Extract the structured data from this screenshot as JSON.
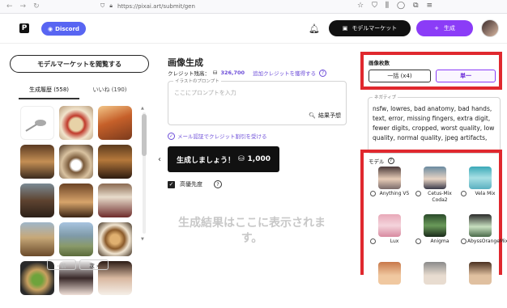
{
  "browser": {
    "url": "https://pixai.art/submit/gen"
  },
  "header": {
    "discord_label": "Discord",
    "market_label": "モデルマーケット",
    "create_label": "生成"
  },
  "left": {
    "browse_label": "モデルマーケットを閲覧する",
    "tabs": [
      {
        "label": "生成履歴 (558)"
      },
      {
        "label": "いいね (190)"
      }
    ],
    "pager": {
      "prev": "‹ 前",
      "next": "次 ›"
    }
  },
  "main": {
    "title": "画像生成",
    "credits_label": "クレジット残高：",
    "credits_value": "326,700",
    "credits_link": "追加クレジットを獲得する",
    "prompt_label": "イラストのプロンプト",
    "prompt_placeholder": "ここにプロンプトを入力",
    "predict_label": "結果予想",
    "mail_label": "メール認証でクレジット割引を受ける",
    "generate_label": "生成しましょう！",
    "generate_cost": "1,000",
    "priority_label": "高優先度",
    "result_placeholder": "生成結果はここに表示されます。"
  },
  "settings": {
    "count_label": "画像枚数",
    "count_options": [
      "一括 (x4)",
      "単一"
    ],
    "negative_label": "ネガティブ",
    "negative_text": "nsfw, lowres, bad anatomy, bad hands, text, error, missing fingers, extra digit, fewer digits, cropped, worst quality, low quality, normal quality, jpeg artifacts,",
    "model_label": "モデル",
    "models": [
      {
        "name": "Anything V5"
      },
      {
        "name": "Cetus-Mix Coda2"
      },
      {
        "name": "Vela Mix"
      },
      {
        "name": "Lux"
      },
      {
        "name": "Anigma"
      },
      {
        "name": "AbyssOrangeMixV3"
      },
      {
        "name": ""
      },
      {
        "name": ""
      },
      {
        "name": ""
      }
    ]
  },
  "colors": {
    "accent": "#8b3cf7",
    "highlight": "#e0282e",
    "discord": "#5865f2"
  }
}
